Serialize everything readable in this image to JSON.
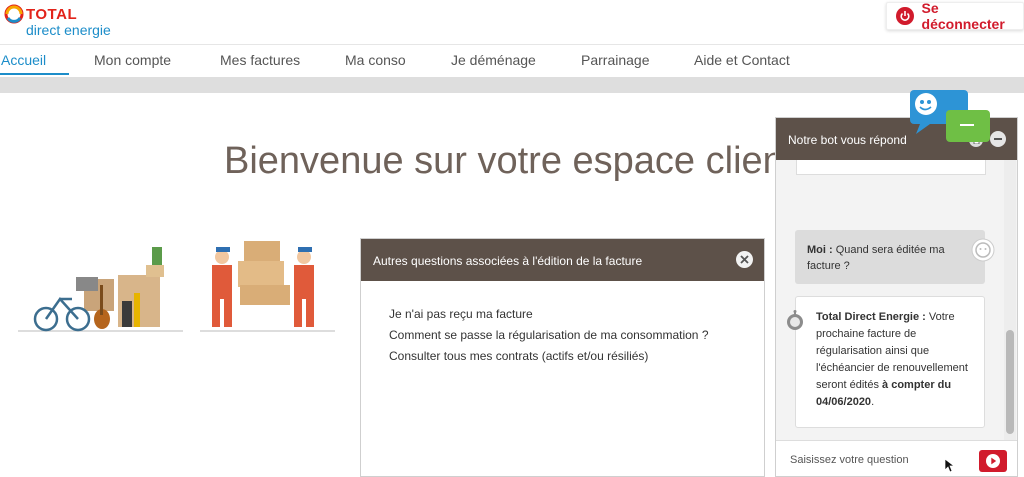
{
  "brand": {
    "name": "TOTAL",
    "subtitle": "direct energie",
    "accent": "#e2231a",
    "blue": "#1c8dc9"
  },
  "header": {
    "logout_label": "Se déconnecter",
    "logout_icon": "power-icon"
  },
  "nav": {
    "items": [
      "Accueil",
      "Mon compte",
      "Mes factures",
      "Ma conso",
      "Je déménage",
      "Parrainage",
      "Aide et Contact"
    ],
    "active": "Accueil"
  },
  "main": {
    "welcome": "Bienvenue sur votre espace clien"
  },
  "modal": {
    "title": "Autres questions associées à l'édition de la facture",
    "links": [
      "Je n'ai pas reçu ma facture",
      "Comment se passe la régularisation de ma consommation ?",
      "Consulter tous mes contrats (actifs et/ou résiliés)"
    ]
  },
  "chat": {
    "title": "Notre bot vous répond",
    "user_name": "Moi :",
    "user_message": "Quand sera éditée ma facture ?",
    "bot_name": "Total Direct Energie :",
    "bot_message": "Votre prochaine facture de régularisation ainsi que l'échéancier de renouvellement seront édités",
    "bot_bold": "à compter du 04/06/2020",
    "bot_end": ".",
    "typing": "• ·",
    "input_placeholder": "Saisissez votre question"
  },
  "colors": {
    "header_brown": "#5d5149",
    "send_red": "#d11b2c",
    "title_brown": "#6f625a"
  }
}
